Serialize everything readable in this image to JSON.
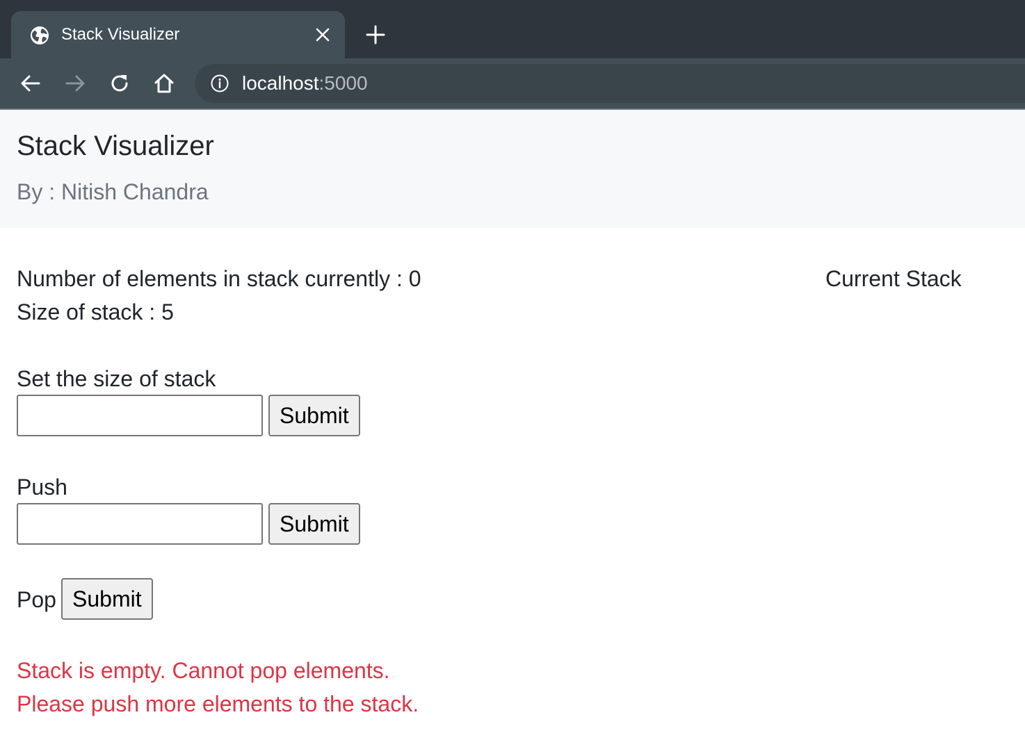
{
  "browser": {
    "tab_title": "Stack Visualizer",
    "url_host": "localhost",
    "url_port": ":5000"
  },
  "header": {
    "title": "Stack Visualizer",
    "subtitle": "By : Nitish Chandra"
  },
  "info": {
    "count_text": "Number of elements in stack currently : 0",
    "size_text": "Size of stack : 5",
    "current_stack_label": "Current Stack"
  },
  "forms": {
    "set_size": {
      "label": "Set the size of stack",
      "value": "",
      "button": "Submit"
    },
    "push": {
      "label": "Push",
      "value": "",
      "button": "Submit"
    },
    "pop": {
      "label": "Pop",
      "button": "Submit"
    }
  },
  "messages": {
    "error_line1": "Stack is empty. Cannot pop elements.",
    "error_line2": "Please push more elements to the stack."
  },
  "colors": {
    "error": "#dc3545",
    "header_bg": "#f7f8fa",
    "chrome_bg": "#2f353c"
  }
}
